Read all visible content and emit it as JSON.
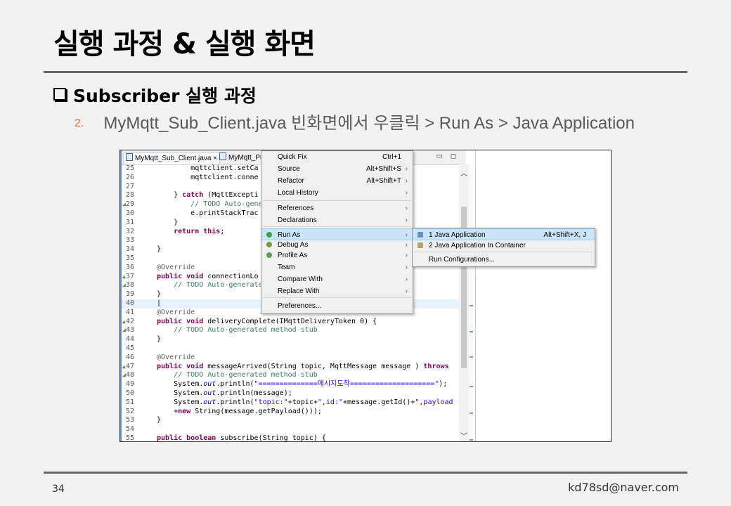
{
  "slide": {
    "title": "실행 과정 & 실행 화면",
    "section": "Subscriber 실행 과정",
    "step_number": "2.",
    "step_text": "MyMqtt_Sub_Client.java 빈화면에서 우클릭 > Run As > Java Application",
    "page_number": "34",
    "email": "kd78sd@naver.com"
  },
  "editor": {
    "tabs": [
      {
        "label": "MyMqtt_Sub_Client.java",
        "close": "×"
      },
      {
        "label": "MyMqtt_Pu"
      }
    ],
    "window_controls": "▭ ◻",
    "lines": [
      {
        "n": "25",
        "code": "            mqttclient.setCa"
      },
      {
        "n": "26",
        "code": "            mqttclient.conne"
      },
      {
        "n": "27",
        "code": ""
      },
      {
        "n": "28",
        "code": "        } catch (MqttExcepti"
      },
      {
        "n": "29",
        "code": "            // TODO Auto-gene"
      },
      {
        "n": "30",
        "code": "            e.printStackTrac"
      },
      {
        "n": "31",
        "code": "        }"
      },
      {
        "n": "32",
        "code": "        return this;"
      },
      {
        "n": "33",
        "code": ""
      },
      {
        "n": "34",
        "code": "    }"
      },
      {
        "n": "35",
        "code": ""
      },
      {
        "n": "36",
        "code": "    @Override"
      },
      {
        "n": "37",
        "code": "    public void connectionLo"
      },
      {
        "n": "38",
        "code": "        // TODO Auto-generate"
      },
      {
        "n": "39",
        "code": "    }"
      },
      {
        "n": "40",
        "code": "    |"
      },
      {
        "n": "41",
        "code": "    @Override"
      },
      {
        "n": "42",
        "code": "    public void deliveryComplete(IMqttDeliveryToken arg0) {"
      },
      {
        "n": "43",
        "code": "        // TODO Auto-generated method stub"
      },
      {
        "n": "44",
        "code": "    }"
      },
      {
        "n": "45",
        "code": ""
      },
      {
        "n": "46",
        "code": "    @Override"
      },
      {
        "n": "47",
        "code": "    public void messageArrived(String topic, MqttMessage message ) throws"
      },
      {
        "n": "48",
        "code": "        // TODO Auto-generated method stub"
      },
      {
        "n": "49",
        "code": "        System.out.println(\"==============메시지도착====================\");"
      },
      {
        "n": "50",
        "code": "        System.out.println(message);"
      },
      {
        "n": "51",
        "code": "        System.out.println(\"topic:\"+topic+\",id:\"+message.getId()+\",payload"
      },
      {
        "n": "52",
        "code": "        +new String(message.getPayload()));"
      },
      {
        "n": "53",
        "code": "    }"
      },
      {
        "n": "54",
        "code": ""
      },
      {
        "n": "55",
        "code": "    public boolean subscribe(String topic) {"
      }
    ]
  },
  "context_menu": {
    "items": [
      {
        "label": "Quick Fix",
        "shortcut": "Ctrl+1",
        "submenu": false
      },
      {
        "label": "Source",
        "shortcut": "Alt+Shift+S",
        "submenu": true
      },
      {
        "label": "Refactor",
        "shortcut": "Alt+Shift+T",
        "submenu": true
      },
      {
        "label": "Local History",
        "shortcut": "",
        "submenu": true
      },
      {
        "label": "References",
        "shortcut": "",
        "submenu": true
      },
      {
        "label": "Declarations",
        "shortcut": "",
        "submenu": true
      },
      {
        "label": "Run As",
        "shortcut": "",
        "submenu": true,
        "icon": "run-icon"
      },
      {
        "label": "Debug As",
        "shortcut": "",
        "submenu": true,
        "icon": "debug-icon"
      },
      {
        "label": "Profile As",
        "shortcut": "",
        "submenu": true,
        "icon": "profile-icon"
      },
      {
        "label": "Team",
        "shortcut": "",
        "submenu": true
      },
      {
        "label": "Compare With",
        "shortcut": "",
        "submenu": true
      },
      {
        "label": "Replace With",
        "shortcut": "",
        "submenu": true
      },
      {
        "label": "Preferences...",
        "shortcut": "",
        "submenu": false
      }
    ],
    "highlighted": "Run As"
  },
  "run_as_menu": {
    "items": [
      {
        "label": "1 Java Application",
        "shortcut": "Alt+Shift+X, J",
        "icon": "java-app-icon"
      },
      {
        "label": "2 Java Application In Container",
        "shortcut": "",
        "icon": "container-icon"
      },
      {
        "label": "Run Configurations...",
        "shortcut": ""
      }
    ],
    "highlighted": "1 Java Application"
  },
  "colors": {
    "accent": "#e07040",
    "highlight": "#cce4f7",
    "keyword": "#7f0055",
    "comment": "#3f7f5f"
  }
}
